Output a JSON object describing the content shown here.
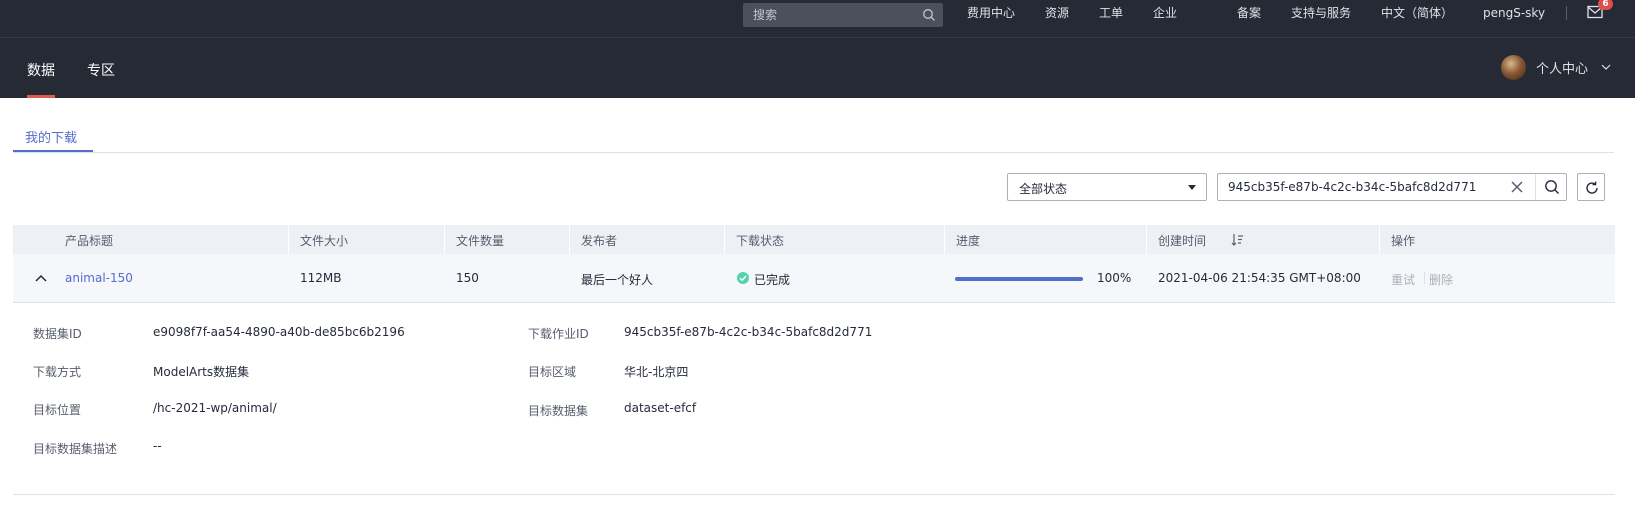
{
  "topbar": {
    "search_placeholder": "搜索",
    "nav": [
      "费用中心",
      "资源",
      "工单",
      "企业",
      "备案",
      "支持与服务",
      "中文（简体）",
      "pengS-sky"
    ],
    "mail_badge": "6"
  },
  "subnav": {
    "tabs": [
      "数据",
      "专区"
    ],
    "active_tab": "数据",
    "user_center": "个人中心"
  },
  "page": {
    "tab_title": "我的下载"
  },
  "filters": {
    "status_value": "全部状态",
    "search_value": "945cb35f-e87b-4c2c-b34c-5bafc8d2d771"
  },
  "table": {
    "headers": [
      "产品标题",
      "文件大小",
      "文件数量",
      "发布者",
      "下载状态",
      "进度",
      "创建时间",
      "操作"
    ],
    "row": {
      "title": "animal-150",
      "size": "112MB",
      "count": "150",
      "publisher": "最后一个好人",
      "status": "已完成",
      "progress_percent": 100,
      "progress_label": "100%",
      "created": "2021-04-06 21:54:35 GMT+08:00",
      "action_retry": "重试",
      "action_delete": "删除"
    }
  },
  "details": {
    "dataset_id_label": "数据集ID",
    "dataset_id": "e9098f7f-aa54-4890-a40b-de85bc6b2196",
    "job_id_label": "下载作业ID",
    "job_id": "945cb35f-e87b-4c2c-b34c-5bafc8d2d771",
    "method_label": "下载方式",
    "method": "ModelArts数据集",
    "region_label": "目标区域",
    "region": "华北-北京四",
    "location_label": "目标位置",
    "location": "/hc-2021-wp/animal/",
    "target_dataset_label": "目标数据集",
    "target_dataset": "dataset-efcf",
    "description_label": "目标数据集描述",
    "description": "--"
  },
  "colors": {
    "topbar_bg": "#252a35",
    "accent": "#526ecc",
    "active_indicator": "#e15b4c",
    "success": "#50d4ab"
  }
}
